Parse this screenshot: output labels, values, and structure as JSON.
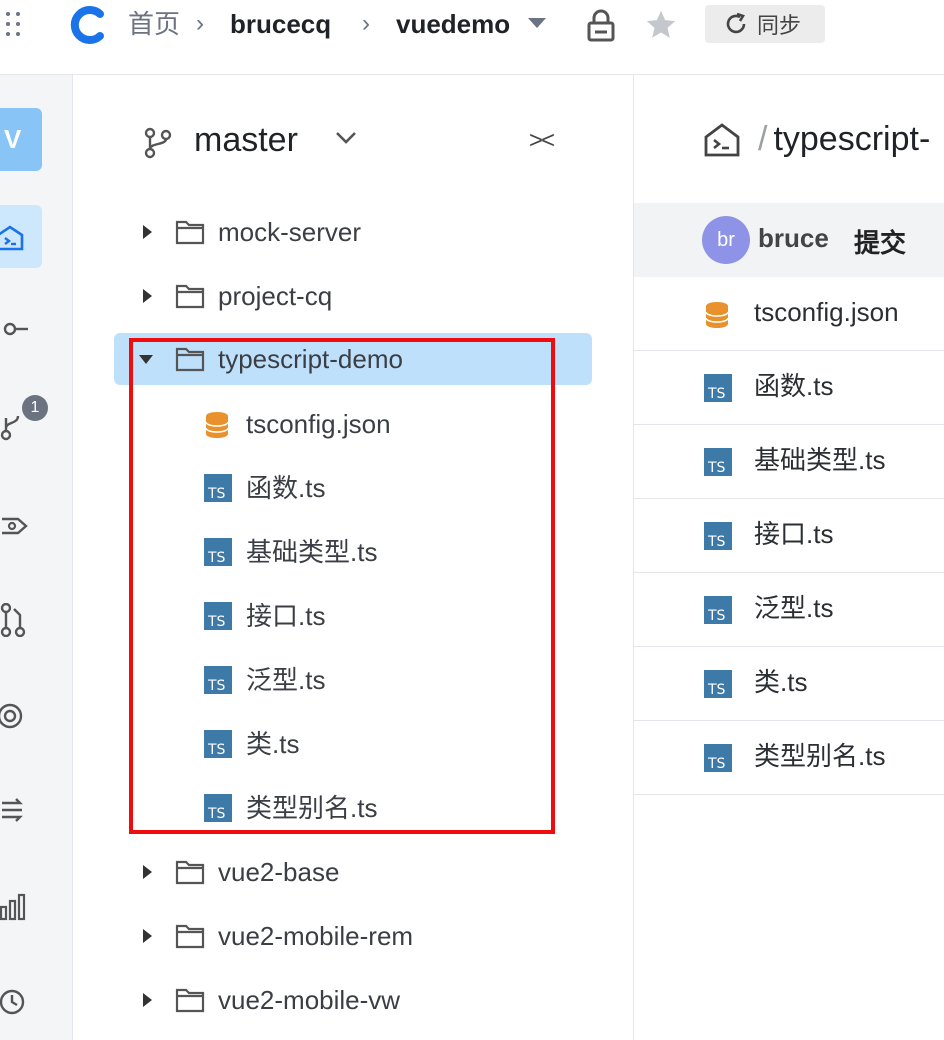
{
  "header": {
    "breadcrumb_home": "首页",
    "breadcrumb_owner": "brucecq",
    "breadcrumb_repo": "vuedemo",
    "sync_label": "同步"
  },
  "rail": {
    "avatar_letter": "V",
    "badge_count": "1"
  },
  "tree": {
    "branch": "master",
    "items": [
      {
        "name": "mock-server",
        "type": "folder",
        "expanded": false
      },
      {
        "name": "project-cq",
        "type": "folder",
        "expanded": false
      },
      {
        "name": "typescript-demo",
        "type": "folder",
        "expanded": true,
        "selected": true,
        "children": [
          {
            "name": "tsconfig.json",
            "type": "json"
          },
          {
            "name": "函数.ts",
            "type": "ts"
          },
          {
            "name": "基础类型.ts",
            "type": "ts"
          },
          {
            "name": "接口.ts",
            "type": "ts"
          },
          {
            "name": "泛型.ts",
            "type": "ts"
          },
          {
            "name": "类.ts",
            "type": "ts"
          },
          {
            "name": "类型别名.ts",
            "type": "ts"
          }
        ]
      },
      {
        "name": "vue2-base",
        "type": "folder",
        "expanded": false
      },
      {
        "name": "vue2-mobile-rem",
        "type": "folder",
        "expanded": false
      },
      {
        "name": "vue2-mobile-vw",
        "type": "folder",
        "expanded": false
      }
    ]
  },
  "content": {
    "path_sep": "/",
    "path": "typescript-",
    "commit_avatar": "br",
    "commit_user": "bruce",
    "commit_message": "提交",
    "files": [
      {
        "name": "tsconfig.json",
        "type": "json"
      },
      {
        "name": "函数.ts",
        "type": "ts"
      },
      {
        "name": "基础类型.ts",
        "type": "ts"
      },
      {
        "name": "接口.ts",
        "type": "ts"
      },
      {
        "name": "泛型.ts",
        "type": "ts"
      },
      {
        "name": "类.ts",
        "type": "ts"
      },
      {
        "name": "类型别名.ts",
        "type": "ts"
      }
    ]
  },
  "colors": {
    "highlight_box": "#ee0c0c",
    "selected_row": "#bfe0fb",
    "logo_blue": "#1a73e8",
    "json_icon": "#e8912d",
    "ts_icon": "#3d7aa8"
  }
}
